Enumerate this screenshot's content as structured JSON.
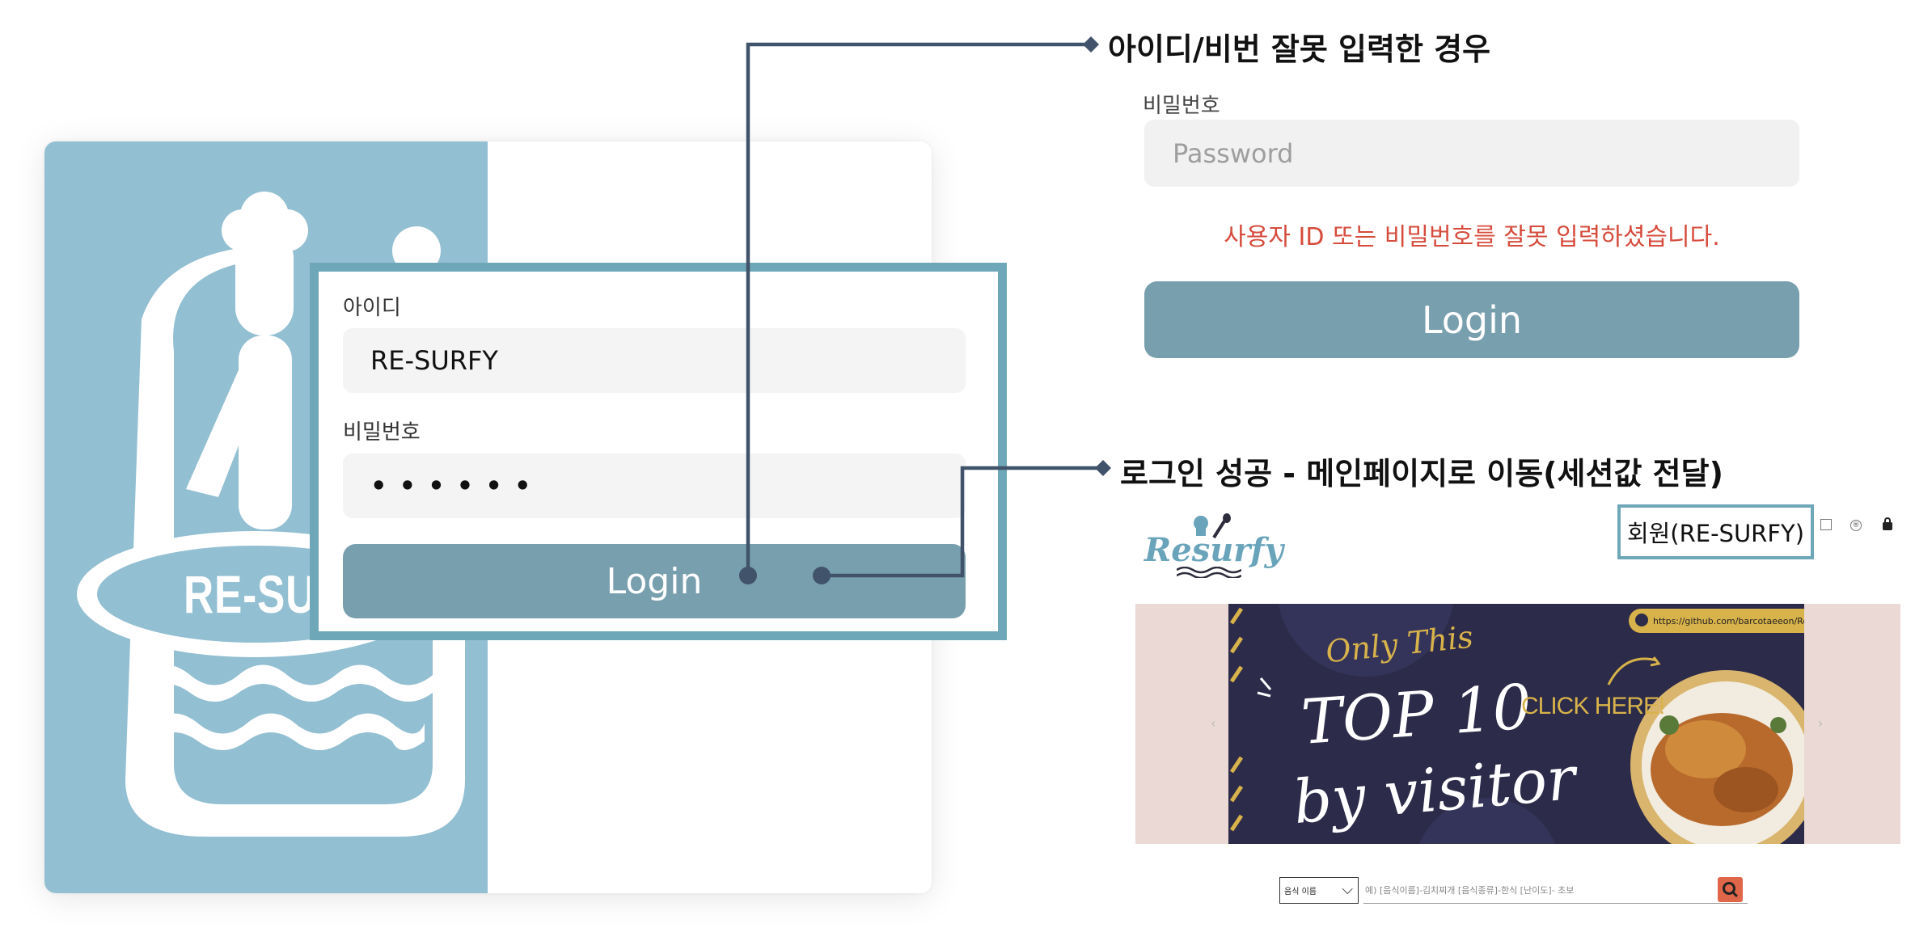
{
  "login_form": {
    "id_label": "아이디",
    "id_value": "RE-SURFY",
    "pw_label": "비밀번호",
    "pw_value": "• • • • • •",
    "login_label": "Login"
  },
  "brand": {
    "logo_text": "RE-SUR"
  },
  "annotations": {
    "error_case": "아이디/비번 잘못 입력한 경우",
    "success_case": "로그인 성공 - 메인페이지로 이동(세션값 전달)"
  },
  "error_panel": {
    "pw_label": "비밀번호",
    "pw_placeholder": "Password",
    "error_message": "사용자 ID 또는 비밀번호를 잘못 입력하셨습니다.",
    "login_label": "Login"
  },
  "main_page": {
    "logo_text": "Resurfy",
    "user_badge": "회원(RE-SURFY)",
    "banner": {
      "url": "https://github.com/barcotaeeon/Re-surfy.git",
      "tagline": "Only This",
      "headline_1": "TOP 10",
      "headline_2": "by visitor",
      "cta": "CLICK HERE!"
    },
    "search": {
      "select_value": "음식 이름",
      "placeholder": "예) [음식이름]-김치찌개 [음식종류]-한식 [난이도]- 초보"
    },
    "colors": {
      "accent": "#6ea7b7",
      "button": "#789fae",
      "error": "#d64b3c",
      "search_button": "#e0664a"
    }
  }
}
